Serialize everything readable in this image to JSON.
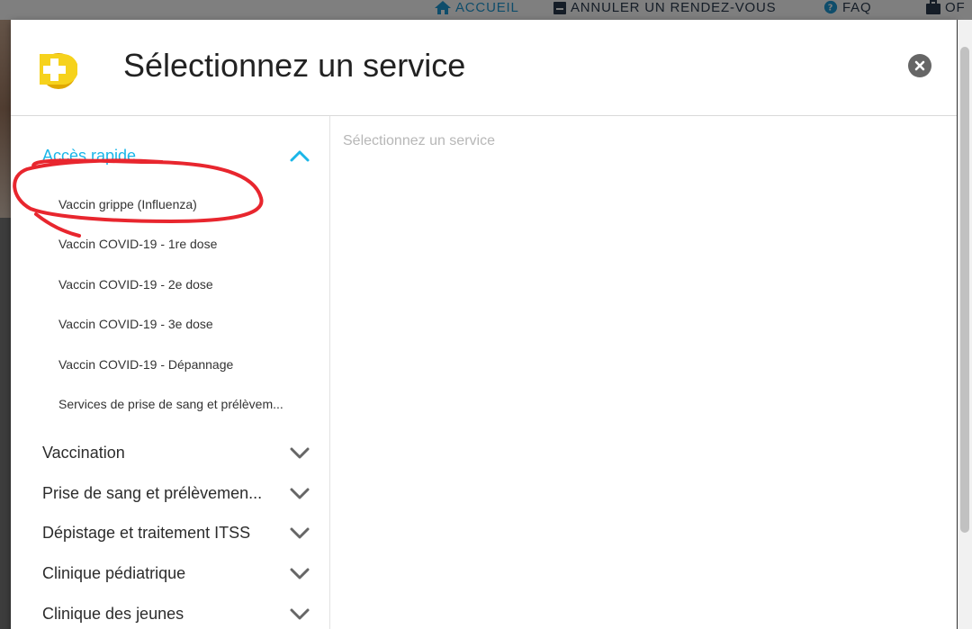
{
  "topnav": {
    "items": [
      {
        "label": "ACCUEIL",
        "icon": "home-icon"
      },
      {
        "label": "ANNULER UN RENDEZ-VOUS",
        "icon": "calendar-icon"
      },
      {
        "label": "FAQ",
        "icon": "help-icon"
      },
      {
        "label": "OF",
        "icon": "briefcase-icon"
      }
    ]
  },
  "modal": {
    "title": "Sélectionnez un service",
    "content_placeholder": "Sélectionnez un service"
  },
  "sidebar": {
    "quick_access": {
      "label": "Accès rapide",
      "expanded": true,
      "items": [
        "Vaccin grippe (Influenza)",
        "Vaccin COVID-19 - 1re dose",
        "Vaccin COVID-19 - 2e dose",
        "Vaccin COVID-19 - 3e dose",
        "Vaccin COVID-19 - Dépannage",
        "Services de prise de sang et prélèvem..."
      ]
    },
    "sections": [
      "Vaccination",
      "Prise de sang et prélèvemen...",
      "Dépistage et traitement ITSS",
      "Clinique pédiatrique",
      "Clinique des jeunes"
    ]
  },
  "colors": {
    "accent": "#1ab6e8",
    "logo_yellow": "#f6d21c",
    "annotation_red": "#e8262e",
    "nav_blue": "#1f9ad6"
  }
}
